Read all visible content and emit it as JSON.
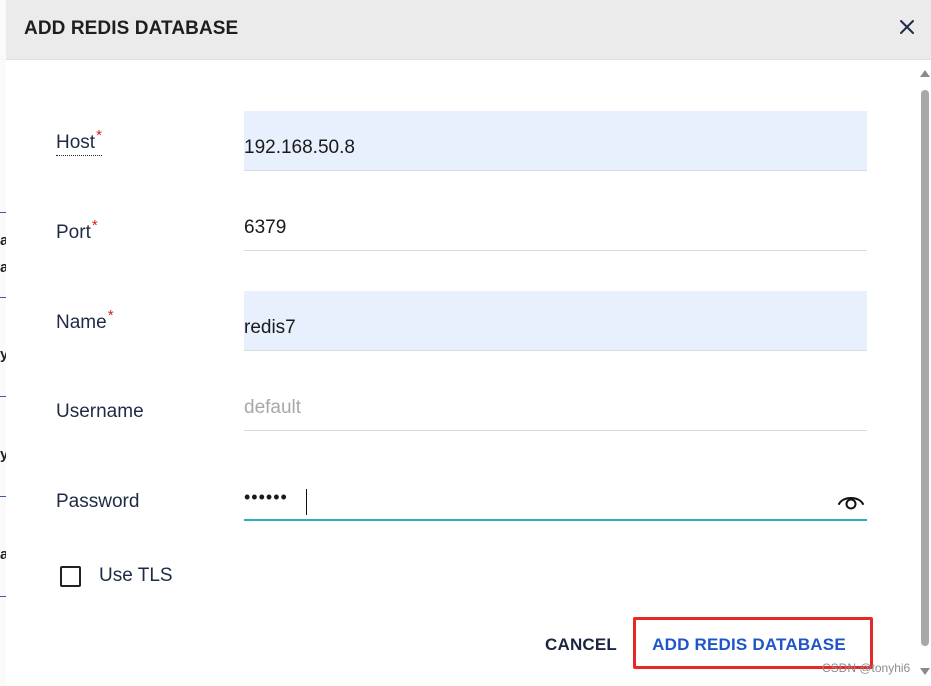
{
  "background": {
    "chars": [
      "a",
      "a",
      "y",
      "y",
      "a"
    ]
  },
  "dialog": {
    "title": "ADD REDIS DATABASE",
    "close_icon": "close-icon"
  },
  "form": {
    "host": {
      "label": "Host",
      "required_mark": "*",
      "value": "192.168.50.8"
    },
    "port": {
      "label": "Port",
      "required_mark": "*",
      "value": "6379"
    },
    "name": {
      "label": "Name",
      "required_mark": "*",
      "value": "redis7"
    },
    "username": {
      "label": "Username",
      "value": "",
      "placeholder": "default"
    },
    "password": {
      "label": "Password",
      "value": "••••••",
      "icon": "eye-icon"
    },
    "tls": {
      "label": "Use TLS",
      "checked": false
    }
  },
  "actions": {
    "cancel_label": "CANCEL",
    "submit_label": "ADD REDIS DATABASE"
  },
  "colors": {
    "accent": "#1f55c9",
    "focus": "#2ab0b8",
    "required": "#d32020",
    "highlight": "#e62828",
    "filled_bg": "#e8effd"
  },
  "watermark": "CSDN @tonyhi6"
}
